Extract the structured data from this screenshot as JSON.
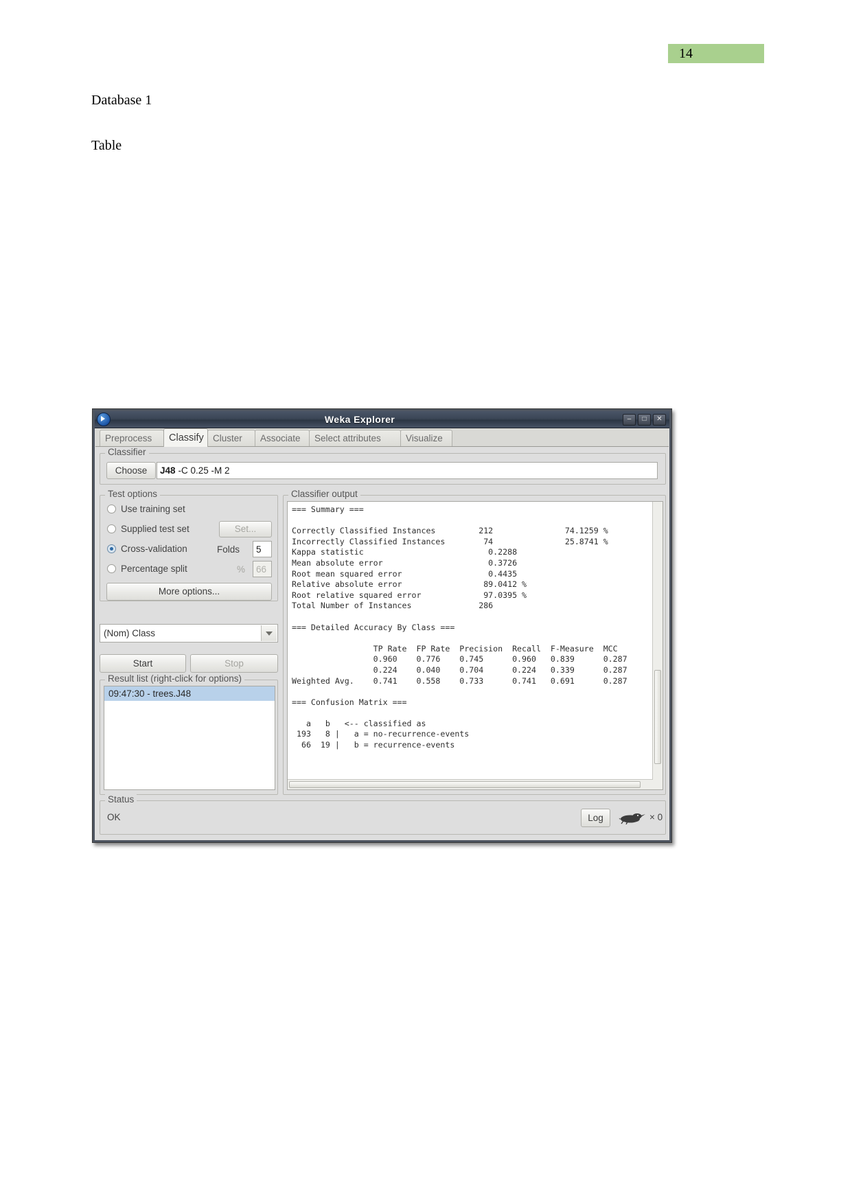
{
  "document": {
    "page_number": "14",
    "heading_1": "Database 1",
    "heading_2": "Table",
    "page_band_color": "#a9d08e"
  },
  "window": {
    "title": "Weka Explorer",
    "icon": "weka-bird-icon",
    "controls": {
      "minimize": "–",
      "maximize": "□",
      "close": "✕"
    }
  },
  "tabs": [
    {
      "label": "Preprocess",
      "selected": false
    },
    {
      "label": "Classify",
      "selected": true
    },
    {
      "label": "Cluster",
      "selected": false
    },
    {
      "label": "Associate",
      "selected": false
    },
    {
      "label": "Select attributes",
      "selected": false
    },
    {
      "label": "Visualize",
      "selected": false
    }
  ],
  "classifier": {
    "group_title": "Classifier",
    "choose_label": "Choose",
    "scheme_name": "J48",
    "scheme_options": "-C 0.25 -M 2"
  },
  "test_options": {
    "group_title": "Test options",
    "options": [
      {
        "label": "Use training set",
        "selected": false
      },
      {
        "label": "Supplied test set",
        "selected": false
      },
      {
        "label": "Cross-validation",
        "selected": true
      },
      {
        "label": "Percentage split",
        "selected": false
      }
    ],
    "set_button": "Set...",
    "folds_label": "Folds",
    "folds_value": "5",
    "percent_label": "%",
    "percent_value": "66",
    "more_options_button": "More options..."
  },
  "class_selector": {
    "value": "(Nom) Class"
  },
  "run_buttons": {
    "start": "Start",
    "stop": "Stop"
  },
  "result_list": {
    "group_title": "Result list (right-click for options)",
    "items": [
      {
        "label": "09:47:30 - trees.J48",
        "selected": true
      }
    ]
  },
  "classifier_output": {
    "group_title": "Classifier output",
    "text": "=== Summary ===\n\nCorrectly Classified Instances         212               74.1259 %\nIncorrectly Classified Instances        74               25.8741 %\nKappa statistic                          0.2288\nMean absolute error                      0.3726\nRoot mean squared error                  0.4435\nRelative absolute error                 89.0412 %\nRoot relative squared error             97.0395 %\nTotal Number of Instances              286\n\n=== Detailed Accuracy By Class ===\n\n                 TP Rate  FP Rate  Precision  Recall  F-Measure  MCC\n                 0.960    0.776    0.745      0.960   0.839      0.287\n                 0.224    0.040    0.704      0.224   0.339      0.287\nWeighted Avg.    0.741    0.558    0.733      0.741   0.691      0.287\n\n=== Confusion Matrix ===\n\n   a   b   <-- classified as\n 193   8 |   a = no-recurrence-events\n  66  19 |   b = recurrence-events"
  },
  "status_bar": {
    "group_title": "Status",
    "status_text": "OK",
    "log_button": "Log",
    "task_count": "× 0"
  },
  "results_summary": {
    "correctly_classified_instances": 212,
    "correctly_classified_percent": "74.1259 %",
    "incorrectly_classified_instances": 74,
    "incorrectly_classified_percent": "25.8741 %",
    "kappa_statistic": 0.2288,
    "mean_absolute_error": 0.3726,
    "root_mean_squared_error": 0.4435,
    "relative_absolute_error": "89.0412 %",
    "root_relative_squared_error": "97.0395 %",
    "total_number_of_instances": 286,
    "detailed_accuracy_headers": [
      "TP Rate",
      "FP Rate",
      "Precision",
      "Recall",
      "F-Measure",
      "MCC"
    ],
    "detailed_accuracy_rows": [
      {
        "name": "",
        "values": [
          0.96,
          0.776,
          0.745,
          0.96,
          0.839,
          0.287
        ]
      },
      {
        "name": "",
        "values": [
          0.224,
          0.04,
          0.704,
          0.224,
          0.339,
          0.287
        ]
      },
      {
        "name": "Weighted Avg.",
        "values": [
          0.741,
          0.558,
          0.733,
          0.741,
          0.691,
          0.287
        ]
      }
    ],
    "confusion_matrix": {
      "labels": [
        "a",
        "b"
      ],
      "rows": [
        {
          "counts": [
            193,
            8
          ],
          "class": "a = no-recurrence-events"
        },
        {
          "counts": [
            66,
            19
          ],
          "class": "b = recurrence-events"
        }
      ]
    }
  }
}
